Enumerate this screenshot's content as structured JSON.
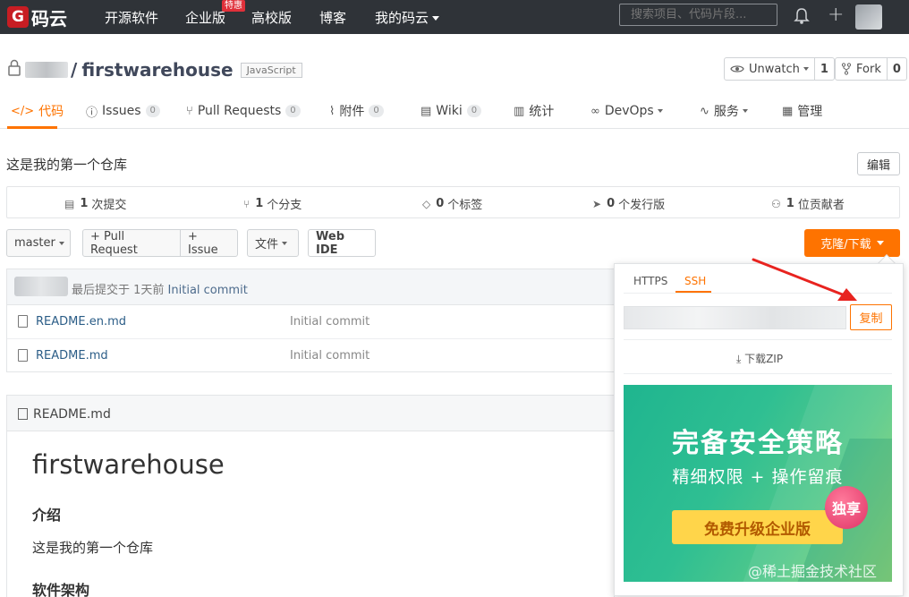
{
  "topnav": {
    "logo_mark": "G",
    "logo_text": "码云",
    "items": [
      "开源软件",
      "企业版",
      "高校版",
      "博客",
      "我的码云"
    ],
    "badge": "特惠",
    "search_placeholder": "搜索项目、代码片段..."
  },
  "repo": {
    "name": "firstwarehouse",
    "language": "JavaScript",
    "unwatch_label": "Unwatch",
    "unwatch_count": "1",
    "fork_label": "Fork",
    "fork_count": "0"
  },
  "tabs": [
    {
      "label": "代码"
    },
    {
      "label": "Issues",
      "count": "0"
    },
    {
      "label": "Pull Requests",
      "count": "0"
    },
    {
      "label": "附件",
      "count": "0"
    },
    {
      "label": "Wiki",
      "count": "0"
    },
    {
      "label": "统计"
    },
    {
      "label": "DevOps"
    },
    {
      "label": "服务"
    },
    {
      "label": "管理"
    }
  ],
  "description": "这是我的第一个仓库",
  "edit_label": "编辑",
  "stats": [
    {
      "num": "1",
      "label": "次提交"
    },
    {
      "num": "1",
      "label": "个分支"
    },
    {
      "num": "0",
      "label": "个标签"
    },
    {
      "num": "0",
      "label": "个发行版"
    },
    {
      "num": "1",
      "label": "位贡献者"
    }
  ],
  "toolbar": {
    "branch": "master",
    "pull_request": "+ Pull Request",
    "issue": "+ Issue",
    "file": "文件",
    "webide": "Web IDE",
    "clone": "克隆/下载"
  },
  "commit": {
    "prefix": "最后提交于 1天前",
    "message": "Initial commit"
  },
  "files": [
    {
      "name": "README.en.md",
      "message": "Initial commit"
    },
    {
      "name": "README.md",
      "message": "Initial commit"
    }
  ],
  "readme": {
    "file": "README.md",
    "h1": "firstwarehouse",
    "h2_intro": "介绍",
    "p": "这是我的第一个仓库",
    "h2_arch": "软件架构"
  },
  "clone_panel": {
    "tab_https": "HTTPS",
    "tab_ssh": "SSH",
    "copy": "复制",
    "download_zip": "下载ZIP",
    "banner_title": "完备安全策略",
    "banner_sub": "精细权限 + 操作留痕",
    "banner_btn": "免费升级企业版",
    "banner_badge": "独享"
  },
  "watermark": "@稀土掘金技术社区",
  "colors": {
    "accent": "#fe7300",
    "nav_bg": "#2f3338",
    "logo_red": "#c71d23"
  }
}
